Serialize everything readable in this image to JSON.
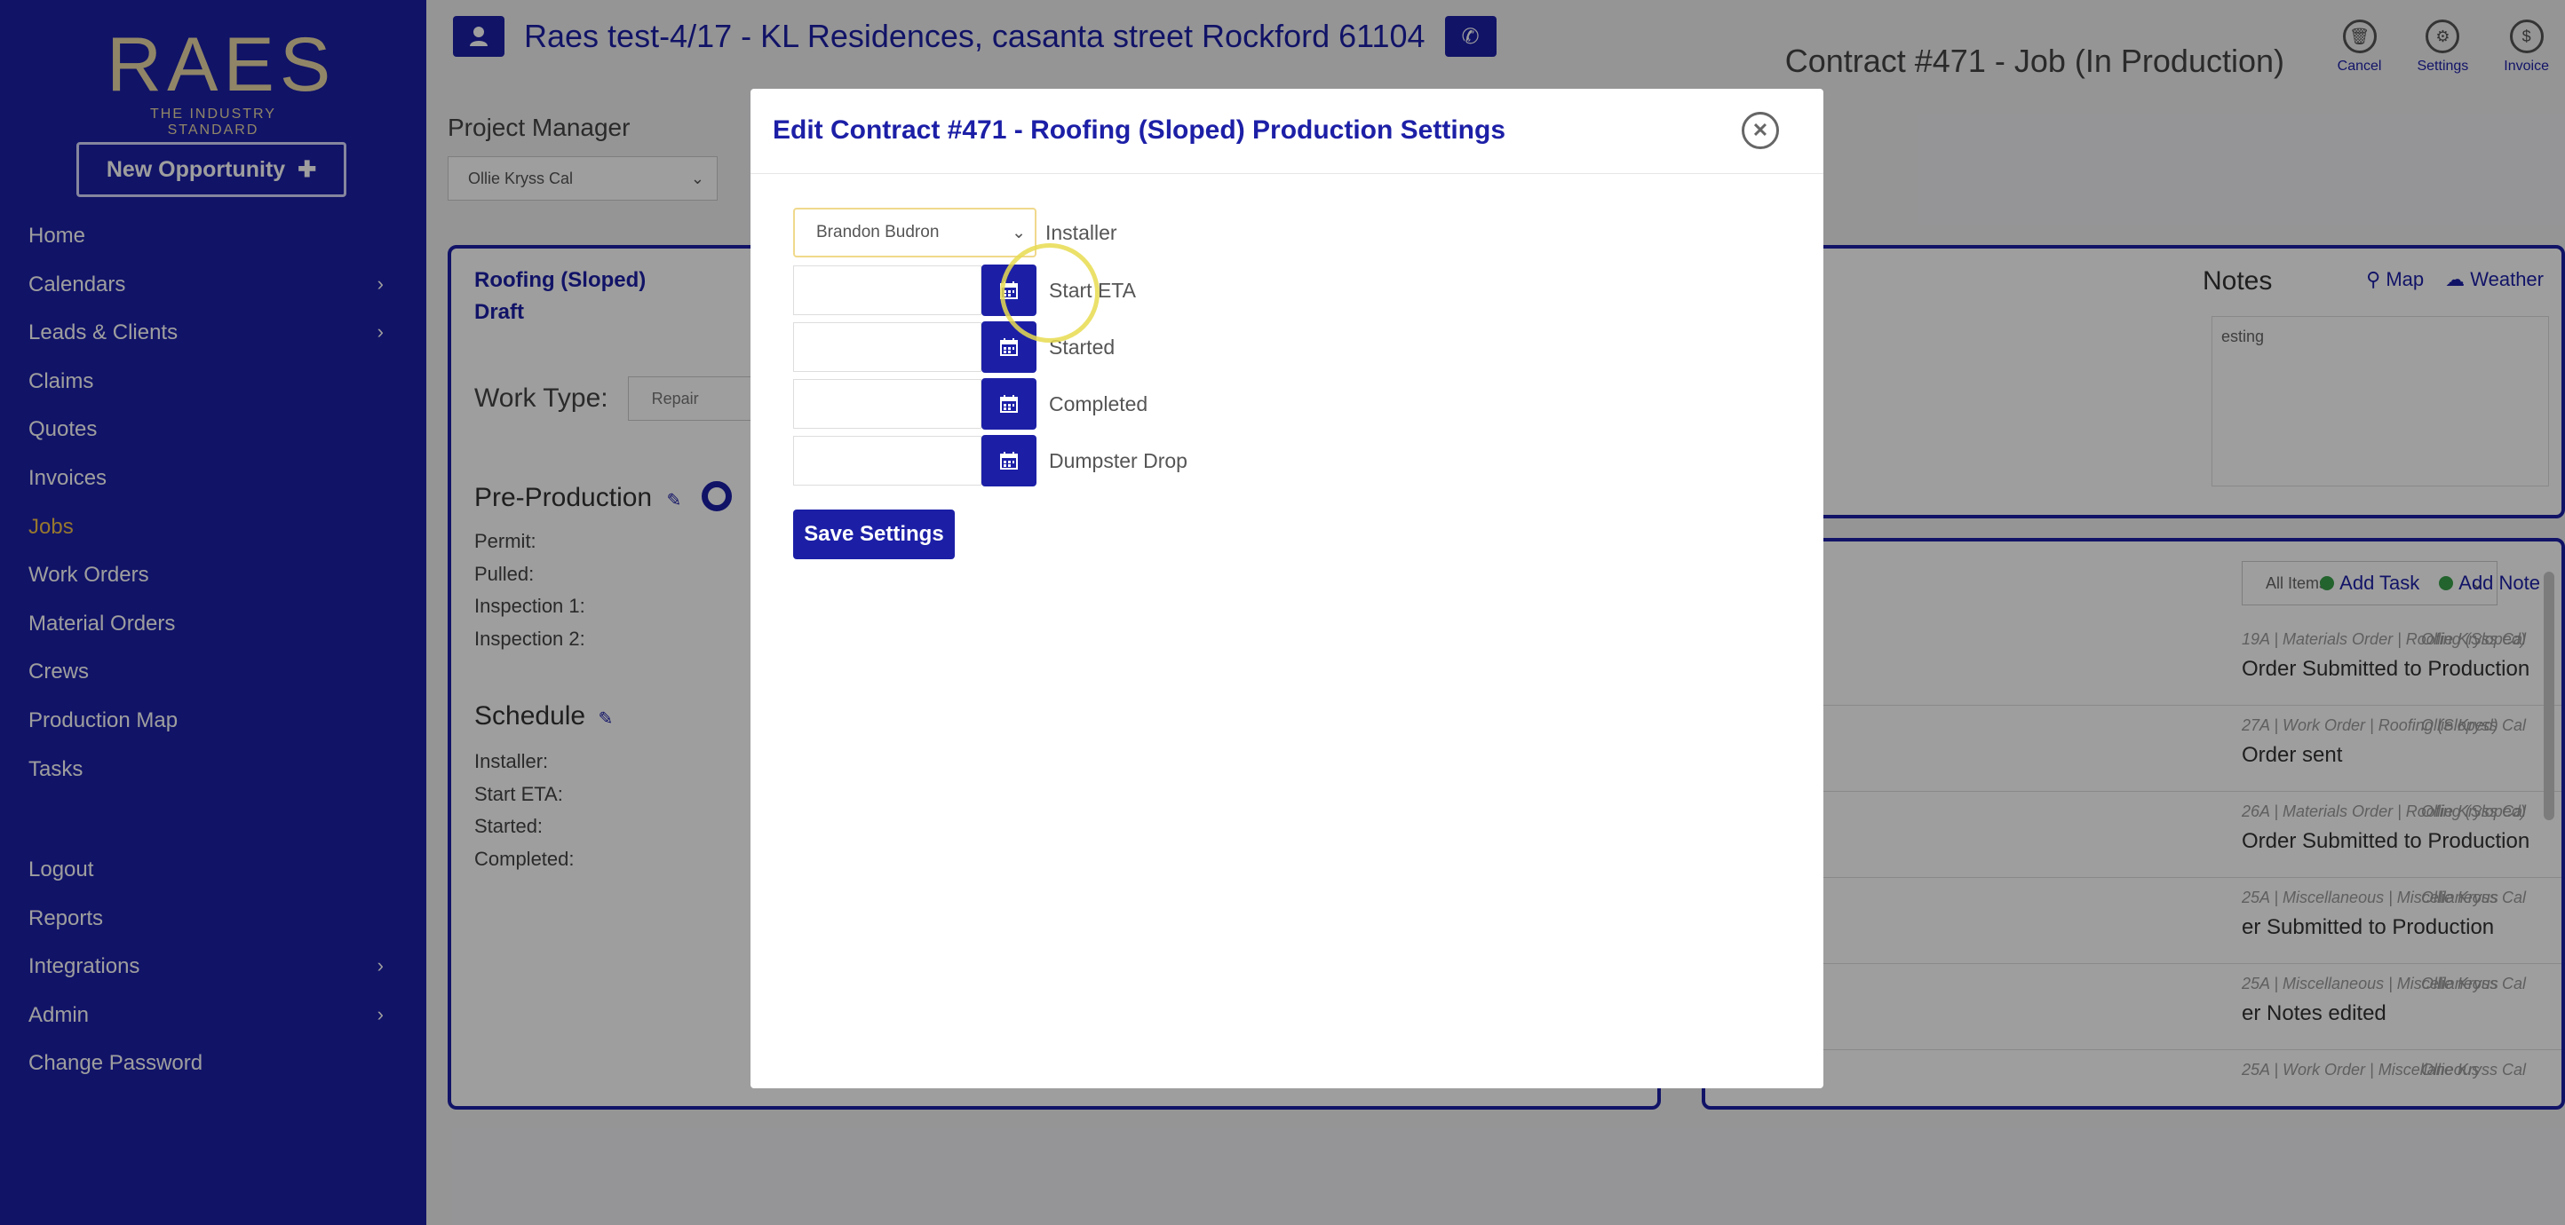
{
  "brand": {
    "logo": "RAES",
    "tagline": "THE INDUSTRY STANDARD"
  },
  "sidebar": {
    "new_opportunity": "New Opportunity",
    "items": [
      {
        "label": "Home",
        "chevron": false,
        "active": false
      },
      {
        "label": "Calendars",
        "chevron": true,
        "active": false
      },
      {
        "label": "Leads & Clients",
        "chevron": true,
        "active": false
      },
      {
        "label": "Claims",
        "chevron": false,
        "active": false
      },
      {
        "label": "Quotes",
        "chevron": false,
        "active": false
      },
      {
        "label": "Invoices",
        "chevron": false,
        "active": false
      },
      {
        "label": "Jobs",
        "chevron": false,
        "active": true
      },
      {
        "label": "Work Orders",
        "chevron": false,
        "active": false
      },
      {
        "label": "Material Orders",
        "chevron": false,
        "active": false
      },
      {
        "label": "Crews",
        "chevron": false,
        "active": false
      },
      {
        "label": "Production Map",
        "chevron": false,
        "active": false
      },
      {
        "label": "Tasks",
        "chevron": false,
        "active": false
      }
    ],
    "bottom_items": [
      {
        "label": "Logout",
        "chevron": false
      },
      {
        "label": "Reports",
        "chevron": false
      },
      {
        "label": "Integrations",
        "chevron": true
      },
      {
        "label": "Admin",
        "chevron": true
      },
      {
        "label": "Change Password",
        "chevron": false
      }
    ],
    "active_color": "#f2c04b"
  },
  "header": {
    "title": "Raes test-4/17 - KL Residences, casanta street Rockford 61104",
    "contract": "Contract #471 - Job (In Production)",
    "actions": [
      {
        "label": "Cancel",
        "icon": "trash-icon"
      },
      {
        "label": "Settings",
        "icon": "gear-icon"
      },
      {
        "label": "Invoice",
        "icon": "dollar-icon"
      }
    ]
  },
  "project_manager": {
    "label": "Project Manager",
    "value": "Ollie Kryss Cal"
  },
  "job_card": {
    "title": "Roofing (Sloped)",
    "status": "Draft",
    "work_type_label": "Work Type:",
    "work_type_value": "Repair",
    "pre_production": "Pre-Production",
    "pre_fields": [
      "Permit:",
      "Pulled:",
      "Inspection 1:",
      "Inspection 2:"
    ],
    "schedule": "Schedule",
    "schedule_fields": [
      "Installer:",
      "Start ETA:",
      "Started:",
      "Completed:"
    ]
  },
  "notes": {
    "title": "Notes",
    "map": "Map",
    "weather": "Weather",
    "text": "esting"
  },
  "activity": {
    "filter": "All Items",
    "add_task": "Add Task",
    "add_note": "Add Note",
    "items": [
      {
        "meta": "19A | Materials Order | Roofing (Sloped)",
        "user": "Ollie Kryss Cal",
        "body": "Order Submitted to Production"
      },
      {
        "meta": "27A | Work Order | Roofing (Sloped)",
        "user": "Ollie Kryss Cal",
        "body": "Order sent"
      },
      {
        "meta": "26A | Materials Order | Roofing (Sloped)",
        "user": "Ollie Kryss Cal",
        "body": "Order Submitted to Production"
      },
      {
        "meta": "25A | Miscellaneous | Miscellaneous",
        "user": "Ollie Kryss Cal",
        "body": "er Submitted to Production"
      },
      {
        "meta": "25A | Miscellaneous | Miscellaneous",
        "user": "Ollie Kryss Cal",
        "body": "er Notes edited"
      },
      {
        "meta": "25A | Work Order | Miscellaneous",
        "user": "Ollie Kryss Cal",
        "body": ""
      }
    ]
  },
  "modal": {
    "title": "Edit Contract #471 - Roofing (Sloped) Production Settings",
    "installer_value": "Brandon Budron",
    "installer_label": "Installer",
    "start_eta_label": "Start ETA",
    "started_label": "Started",
    "completed_label": "Completed",
    "dumpster_label": "Dumpster Drop",
    "save": "Save Settings"
  },
  "colors": {
    "primary": "#1c1fa6",
    "accent": "#f2c04b",
    "success": "#39a04a"
  }
}
